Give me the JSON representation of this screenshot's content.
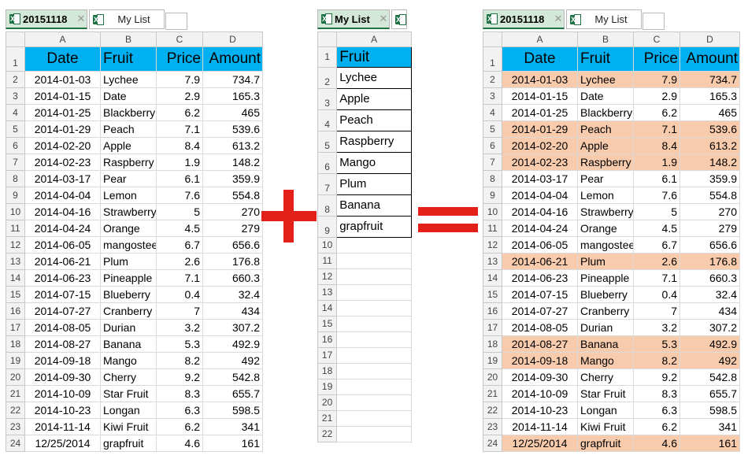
{
  "left_sheet": {
    "tabs": [
      {
        "label": "20151118",
        "active": true
      },
      {
        "label": "My List",
        "active": false
      }
    ],
    "columns": [
      "A",
      "B",
      "C",
      "D"
    ],
    "headers": [
      "Date",
      "Fruit",
      "Price",
      "Amount"
    ],
    "rows": [
      [
        "2014-01-03",
        "Lychee",
        "7.9",
        "734.7"
      ],
      [
        "2014-01-15",
        "Date",
        "2.9",
        "165.3"
      ],
      [
        "2014-01-25",
        "Blackberry",
        "6.2",
        "465"
      ],
      [
        "2014-01-29",
        "Peach",
        "7.1",
        "539.6"
      ],
      [
        "2014-02-20",
        "Apple",
        "8.4",
        "613.2"
      ],
      [
        "2014-02-23",
        "Raspberry",
        "1.9",
        "148.2"
      ],
      [
        "2014-03-17",
        "Pear",
        "6.1",
        "359.9"
      ],
      [
        "2014-04-04",
        "Lemon",
        "7.6",
        "554.8"
      ],
      [
        "2014-04-16",
        "Strawberry",
        "5",
        "270"
      ],
      [
        "2014-04-24",
        "Orange",
        "4.5",
        "279"
      ],
      [
        "2014-06-05",
        "mangosteen",
        "6.7",
        "656.6"
      ],
      [
        "2014-06-21",
        "Plum",
        "2.6",
        "176.8"
      ],
      [
        "2014-06-23",
        "Pineapple",
        "7.1",
        "660.3"
      ],
      [
        "2014-07-15",
        "Blueberry",
        "0.4",
        "32.4"
      ],
      [
        "2014-07-27",
        "Cranberry",
        "7",
        "434"
      ],
      [
        "2014-08-05",
        "Durian",
        "3.2",
        "307.2"
      ],
      [
        "2014-08-27",
        "Banana",
        "5.3",
        "492.9"
      ],
      [
        "2014-09-18",
        "Mango",
        "8.2",
        "492"
      ],
      [
        "2014-09-30",
        "Cherry",
        "9.2",
        "542.8"
      ],
      [
        "2014-10-09",
        "Star Fruit",
        "8.3",
        "655.7"
      ],
      [
        "2014-10-23",
        "Longan",
        "6.3",
        "598.5"
      ],
      [
        "2014-11-14",
        "Kiwi Fruit",
        "6.2",
        "341"
      ],
      [
        "12/25/2014",
        "grapfruit",
        "4.6",
        "161"
      ]
    ]
  },
  "list_sheet": {
    "tabs": [
      {
        "label": "My List",
        "active": true
      }
    ],
    "columns": [
      "A"
    ],
    "header": "Fruit",
    "items": [
      "Lychee",
      "Apple",
      "Peach",
      "Raspberry",
      "Mango",
      "Plum",
      "Banana",
      "grapfruit"
    ],
    "empty_rows": [
      "10",
      "11",
      "12",
      "13",
      "14",
      "15",
      "16",
      "17",
      "18",
      "19",
      "20",
      "21",
      "22"
    ]
  },
  "right_sheet": {
    "tabs": [
      {
        "label": "20151118",
        "active": true
      },
      {
        "label": "My List",
        "active": false
      }
    ],
    "columns": [
      "A",
      "B",
      "C",
      "D"
    ],
    "highlighted_rows": [
      2,
      5,
      6,
      7,
      13,
      18,
      19,
      24
    ],
    "highlight_color": "#f8cbad",
    "header_color": "#00b0f0"
  },
  "operators": {
    "plus_color": "#e32119",
    "equals_color": "#e32119"
  }
}
